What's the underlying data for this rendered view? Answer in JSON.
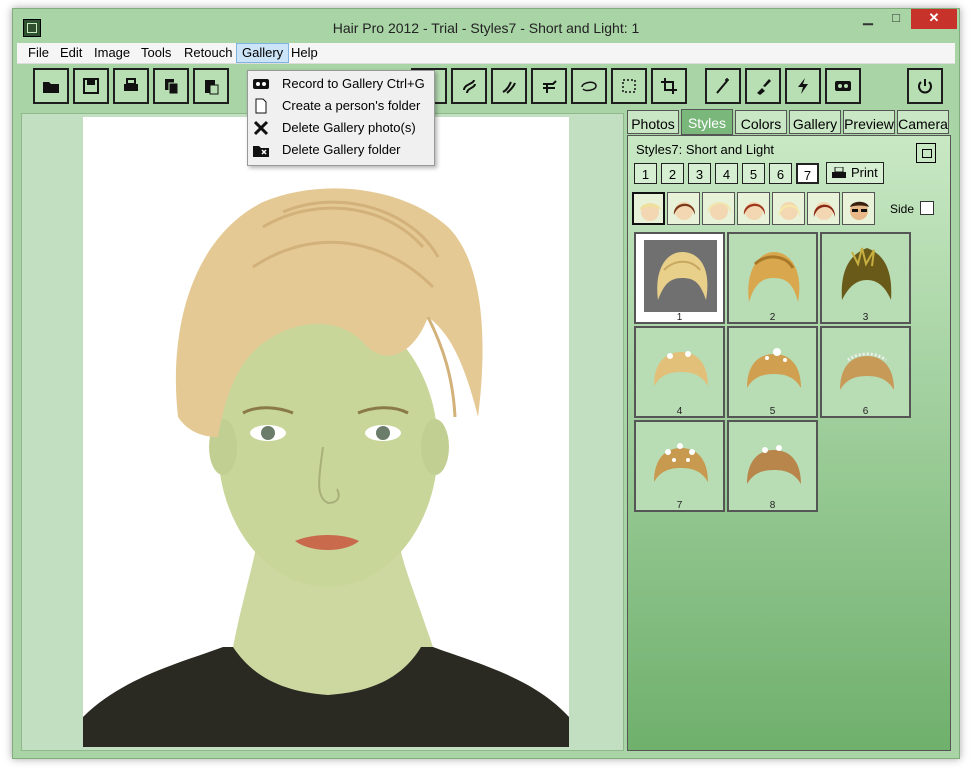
{
  "window": {
    "title": "Hair Pro 2012 - Trial - Styles7 - Short and Light: 1",
    "minimize": "▁",
    "maximize": "□",
    "close": "✕"
  },
  "menubar": {
    "items": [
      "File",
      "Edit",
      "Image",
      "Tools",
      "Retouch",
      "Gallery",
      "Help"
    ],
    "active": "Gallery"
  },
  "gallery_menu": {
    "items": [
      {
        "label": "Record to Gallery Ctrl+G",
        "icon": "tape-icon"
      },
      {
        "label": "Create a person's folder",
        "icon": "new-page-icon"
      },
      {
        "label": "Delete Gallery photo(s)",
        "icon": "x-delete-icon"
      },
      {
        "label": "Delete Gallery folder",
        "icon": "folder-delete-icon"
      }
    ]
  },
  "toolbar": {
    "icons": [
      "open-folder-icon",
      "save-disk-icon",
      "print-icon",
      "copy-icon",
      "paste-icon",
      "drop-icon",
      "hairdryer-icon",
      "curl-icon",
      "airbrush-icon",
      "lasso-icon",
      "select-rect-icon",
      "crop-icon",
      "magic-wand-icon",
      "brush-icon",
      "lightning-icon",
      "tape-icon",
      "power-icon"
    ]
  },
  "tabs": {
    "items": [
      "Photos",
      "Styles",
      "Colors",
      "Gallery",
      "Preview",
      "Camera"
    ],
    "active": "Styles"
  },
  "styles_panel": {
    "title": "Styles7: Short and Light",
    "numbers": [
      "1",
      "2",
      "3",
      "4",
      "5",
      "6",
      "7"
    ],
    "active_number": "7",
    "print_label": "Print",
    "side_label": "Side",
    "side_checked": false,
    "faces": [
      "blonde-woman-icon",
      "brunette-woman-icon",
      "blonde-curly-woman-icon",
      "redhead-woman-icon",
      "blonde-bob-woman-icon",
      "auburn-woman-icon",
      "man-sunglasses-icon"
    ],
    "thumbnail_labels": [
      "1",
      "2",
      "3",
      "4",
      "5",
      "6",
      "7",
      "8"
    ],
    "selected_thumbnail": "1"
  },
  "colors": {
    "window_bg": "#a9d4a6",
    "panel_bg": "#c3dfc1",
    "close_red": "#c7322b",
    "menu_highlight": "#cce4f7",
    "hair_blonde": "#e5c994",
    "skin_green": "#c8d69a"
  }
}
